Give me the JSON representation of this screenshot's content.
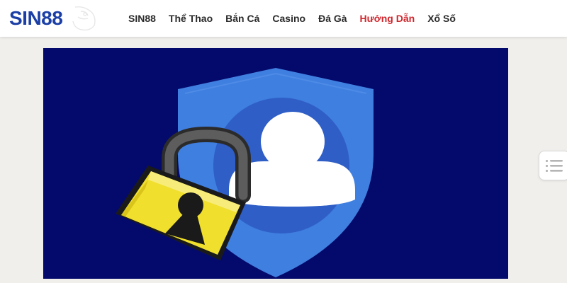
{
  "header": {
    "logo_text": "SIN88",
    "nav": [
      {
        "label": "SIN88",
        "active": false
      },
      {
        "label": "Thể Thao",
        "active": false
      },
      {
        "label": "Bắn Cá",
        "active": false
      },
      {
        "label": "Casino",
        "active": false
      },
      {
        "label": "Đá Gà",
        "active": false
      },
      {
        "label": "Hướng Dẫn",
        "active": true
      },
      {
        "label": "Xổ Số",
        "active": false
      }
    ]
  },
  "banner": {
    "background_color": "#040a6b",
    "shield_color": "#3f7fe0",
    "user_circle_color": "#2f5ec7",
    "padlock_color": "#f1df2d"
  },
  "colors": {
    "brand": "#1b3fa6",
    "accent": "#d0262c"
  },
  "toc": {
    "icon": "list-icon"
  }
}
